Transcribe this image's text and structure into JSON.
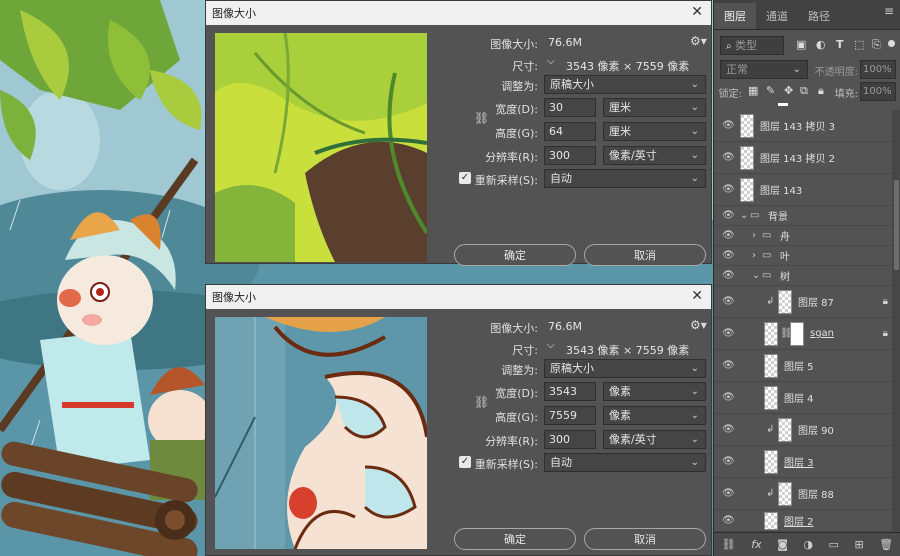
{
  "colors": {
    "dialog_bg": "#535353",
    "title_bar": "#f0f0f0",
    "panel_bg": "#535353",
    "accent": "#ffffff"
  },
  "dialog_top": {
    "title": "图像大小",
    "image_size_label": "图像大小:",
    "image_size_value": "76.6M",
    "dimension_label": "尺寸:",
    "dimension_value": "3543 像素 × 7559 像素",
    "fit_to_label": "调整为:",
    "fit_to_value": "原稿大小",
    "width_label": "宽度(D):",
    "width_value": "30",
    "width_unit": "厘米",
    "height_label": "高度(G):",
    "height_value": "64",
    "height_unit": "厘米",
    "resolution_label": "分辨率(R):",
    "resolution_value": "300",
    "resolution_unit": "像素/英寸",
    "resample_label": "重新采样(S):",
    "resample_value": "自动",
    "ok_label": "确定",
    "cancel_label": "取消"
  },
  "dialog_bottom": {
    "title": "图像大小",
    "image_size_label": "图像大小:",
    "image_size_value": "76.6M",
    "dimension_label": "尺寸:",
    "dimension_value": "3543 像素 × 7559 像素",
    "fit_to_label": "调整为:",
    "fit_to_value": "原稿大小",
    "width_label": "宽度(D):",
    "width_value": "3543",
    "width_unit": "像素",
    "height_label": "高度(G):",
    "height_value": "7559",
    "height_unit": "像素",
    "resolution_label": "分辨率(R):",
    "resolution_value": "300",
    "resolution_unit": "像素/英寸",
    "resample_label": "重新采样(S):",
    "resample_value": "自动",
    "ok_label": "确定",
    "cancel_label": "取消"
  },
  "layers_panel": {
    "tabs": [
      "图层",
      "通道",
      "路径"
    ],
    "filter_placeholder": "类型",
    "blend_mode": "正常",
    "opacity_label": "不透明度:",
    "opacity_value": "100%",
    "lock_label": "锁定:",
    "fill_label": "填充:",
    "fill_value": "100%",
    "layers": [
      {
        "name": "图层 143 拷贝 3"
      },
      {
        "name": "图层 143 拷贝 2"
      },
      {
        "name": "图层 143"
      },
      {
        "name": "背景"
      },
      {
        "name": "舟"
      },
      {
        "name": "叶"
      },
      {
        "name": "树"
      },
      {
        "name": "图层 87"
      },
      {
        "name": "sgan"
      },
      {
        "name": "图层 5"
      },
      {
        "name": "图层 4"
      },
      {
        "name": "图层 90"
      },
      {
        "name": "图层 3"
      },
      {
        "name": "图层 88"
      },
      {
        "name": "图层 2"
      }
    ],
    "bottom_icons": [
      "link-icon",
      "fx-icon",
      "mask-icon",
      "adjustment-icon",
      "group-icon",
      "new-layer-icon",
      "trash-icon"
    ]
  }
}
